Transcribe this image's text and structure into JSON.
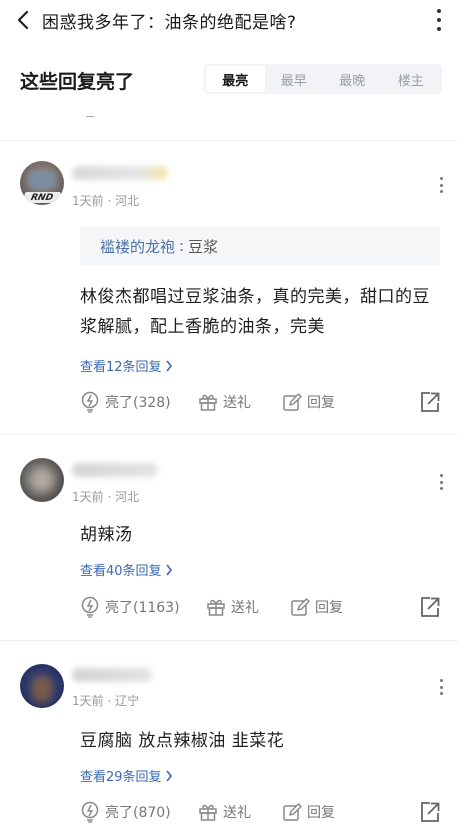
{
  "header": {
    "title": "困惑我多年了：油条的绝配是啥?",
    "back_icon": "chevron-left-icon",
    "more_icon": "more-vertical-icon"
  },
  "replies_section": {
    "title": "这些回复亮了",
    "sort_tabs": [
      {
        "label": "最亮",
        "active": true
      },
      {
        "label": "最早",
        "active": false
      },
      {
        "label": "最晚",
        "active": false
      },
      {
        "label": "楼主",
        "active": false
      }
    ]
  },
  "comments": [
    {
      "meta": "1天前 · 河北",
      "quote": {
        "author": "褴褛的龙袍",
        "separator": ":",
        "text": "豆浆"
      },
      "body": "林俊杰都唱过豆浆油条，真的完美，甜口的豆浆解腻，配上香脆的油条，完美",
      "replies_label": "查看12条回复",
      "like_label": "亮了(328)",
      "gift_label": "送礼",
      "reply_label": "回复"
    },
    {
      "meta": "1天前 · 河北",
      "body": "胡辣汤",
      "replies_label": "查看40条回复",
      "like_label": "亮了(1163)",
      "gift_label": "送礼",
      "reply_label": "回复"
    },
    {
      "meta": "1天前 · 辽宁",
      "body": "豆腐脑 放点辣椒油 韭菜花",
      "replies_label": "查看29条回复",
      "like_label": "亮了(870)",
      "gift_label": "送礼",
      "reply_label": "回复"
    }
  ],
  "avatar_badge": "RND",
  "colors": {
    "link_blue": "#3b6ab5",
    "quote_blue": "#4a6fa5",
    "muted_gray": "#999999",
    "tab_bg": "#f1f3f6"
  }
}
